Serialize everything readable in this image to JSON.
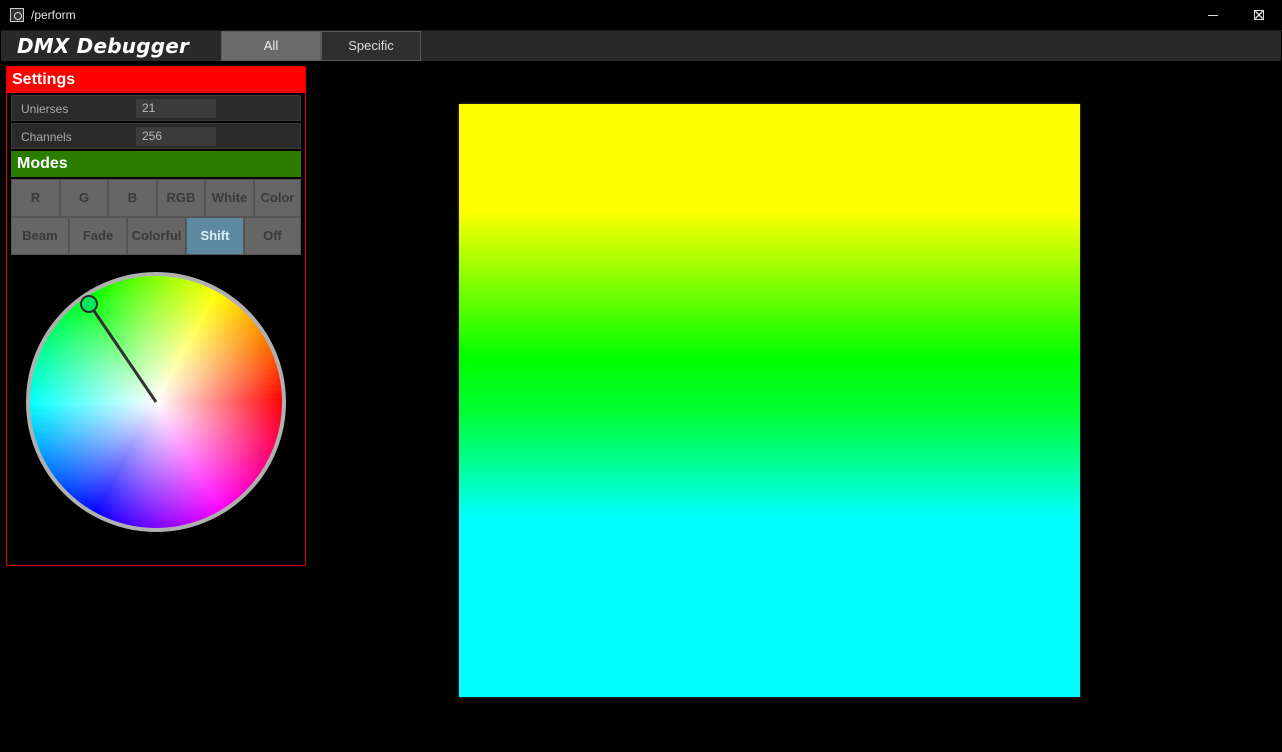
{
  "window": {
    "title": "/perform"
  },
  "app": {
    "name": "DMX Debugger"
  },
  "tabs": [
    {
      "label": "All",
      "active": true
    },
    {
      "label": "Specific",
      "active": false
    }
  ],
  "settings": {
    "header": "Settings",
    "universes": {
      "label": "Unierses",
      "value": "21"
    },
    "channels": {
      "label": "Channels",
      "value": "256"
    }
  },
  "modes": {
    "header": "Modes",
    "row1": [
      "R",
      "G",
      "B",
      "RGB",
      "White",
      "Color"
    ],
    "row2": [
      "Beam",
      "Fade",
      "Colorful",
      "Shift",
      "Off"
    ],
    "active": "Shift"
  },
  "colors": {
    "settings_header": "#ff0000",
    "modes_header": "#2b7d00",
    "active_mode": "#5d8aa0",
    "display_top": "#ffff00",
    "display_mid": "#00ff00",
    "display_bottom": "#00ffff"
  },
  "color_wheel": {
    "selected_color": "#00ff55"
  }
}
